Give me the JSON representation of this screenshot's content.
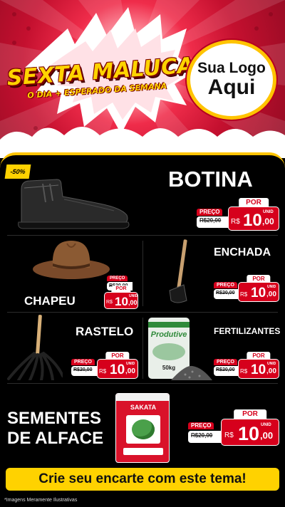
{
  "header": {
    "headline": "SEXTA MALUCA!",
    "subheadline": "O DIA + ESPERADO DA SEMANA",
    "logo_line1": "Sua Logo",
    "logo_line2": "Aqui"
  },
  "products": [
    {
      "name": "BOTINA",
      "badge": "-50%",
      "old_label": "PREÇO",
      "old_price": "R$20,00",
      "new_label": "POR",
      "currency": "R$",
      "price": "10",
      "cents": ",00",
      "unit": "UNID",
      "icon": "boot-image"
    },
    {
      "name": "CHAPEU",
      "old_label": "PREÇO",
      "old_price": "R$20,00",
      "new_label": "POR",
      "currency": "R$",
      "price": "10",
      "cents": ",00",
      "unit": "UNID",
      "icon": "hat-image"
    },
    {
      "name": "ENCHADA",
      "old_label": "PREÇO",
      "old_price": "R$20,00",
      "new_label": "POR",
      "currency": "R$",
      "price": "10",
      "cents": ",00",
      "unit": "UNID",
      "icon": "hoe-image"
    },
    {
      "name": "RASTELO",
      "old_label": "PREÇO",
      "old_price": "R$20,00",
      "new_label": "POR",
      "currency": "R$",
      "price": "10",
      "cents": ",00",
      "unit": "UNID",
      "icon": "rake-image"
    },
    {
      "name": "FERTILIZANTES",
      "old_label": "PREÇO",
      "old_price": "R$20,00",
      "new_label": "POR",
      "currency": "R$",
      "price": "10",
      "cents": ",00",
      "unit": "UNID",
      "icon": "fertilizer-bag-image",
      "bag_brand": "Produtive",
      "bag_weight": "50kg"
    },
    {
      "name_line1": "SEMENTES",
      "name_line2": "DE ALFACE",
      "old_label": "PREÇO",
      "old_price": "R$20,00",
      "new_label": "POR",
      "currency": "R$",
      "price": "10",
      "cents": ",00",
      "unit": "UNID",
      "icon": "seed-packet-image",
      "packet_brand": "SAKATA"
    }
  ],
  "cta": "Crie seu encarte com este tema!",
  "footnote": "*Imagens Meramente Ilustrativas",
  "colors": {
    "accent_red": "#d6001c",
    "accent_yellow": "#ffd200",
    "background": "#000000"
  }
}
